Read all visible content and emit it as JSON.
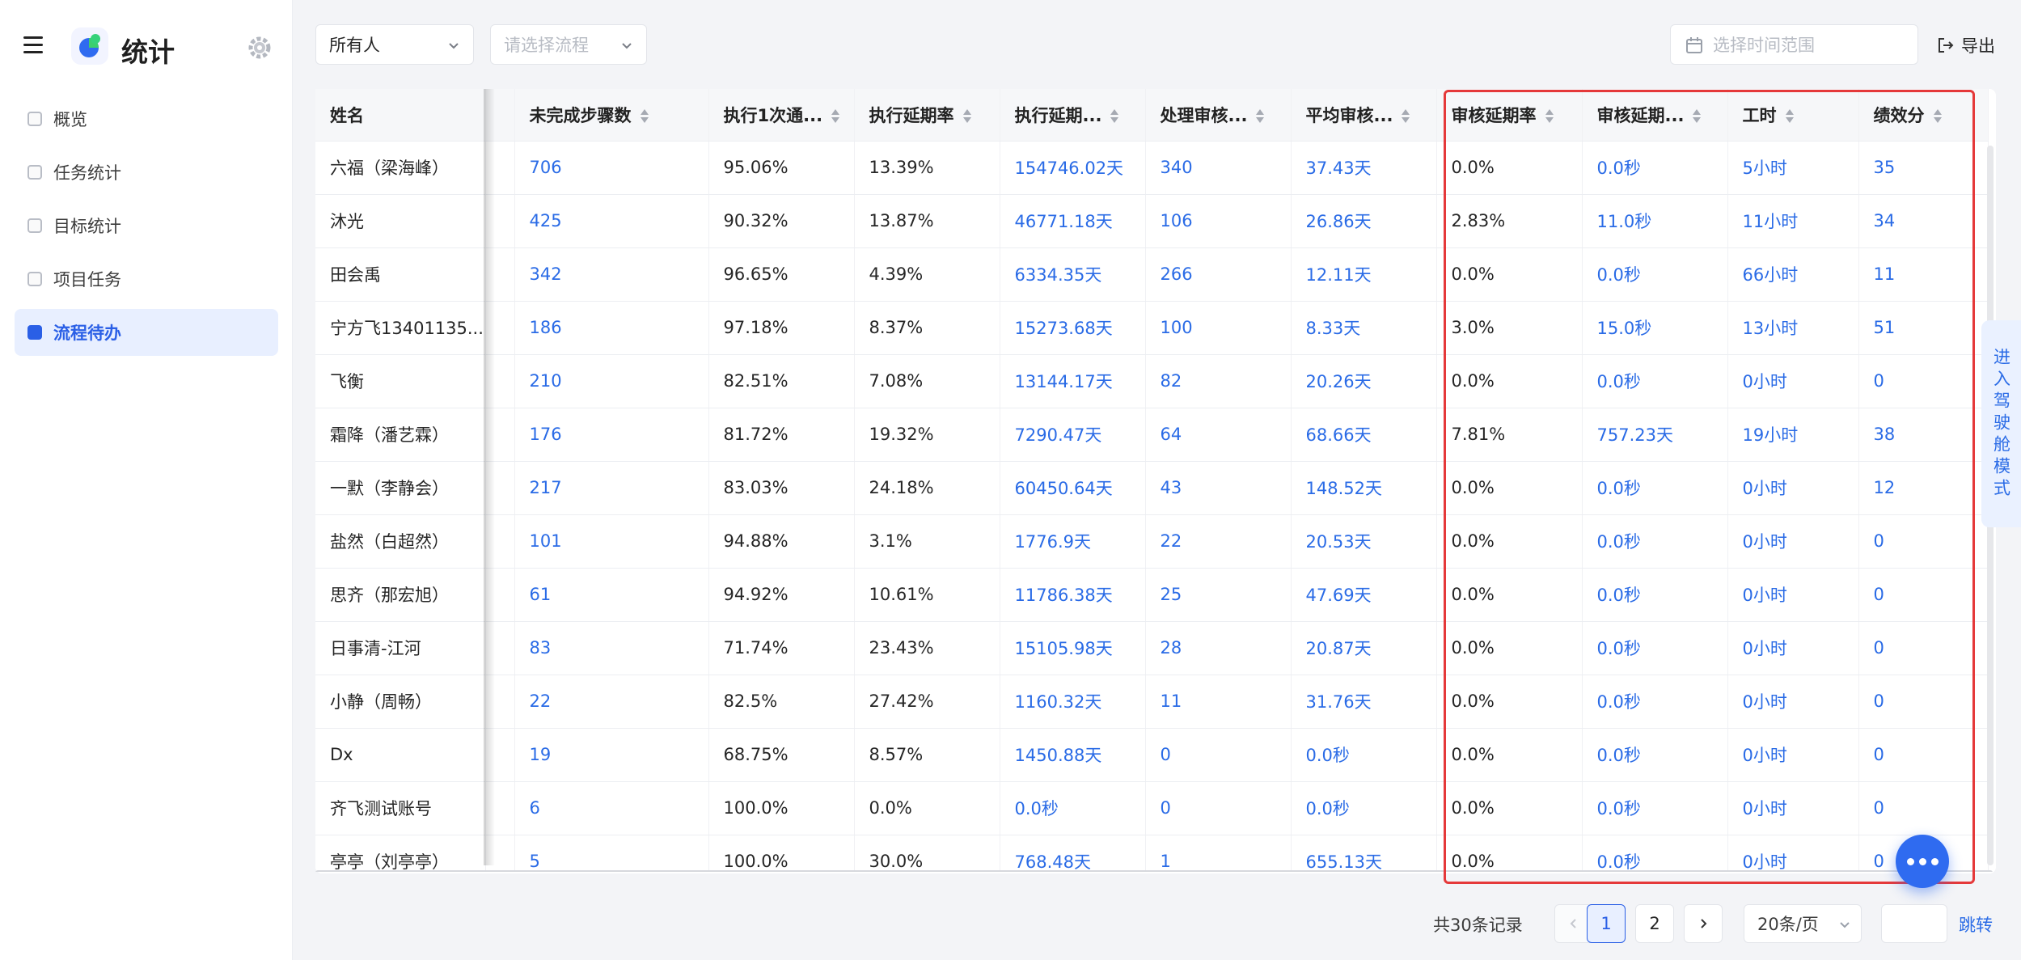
{
  "app": {
    "title": "统计"
  },
  "sidebar": {
    "items": [
      {
        "label": "概览"
      },
      {
        "label": "任务统计"
      },
      {
        "label": "目标统计"
      },
      {
        "label": "项目任务"
      },
      {
        "label": "流程待办"
      }
    ],
    "active_index": 4
  },
  "toolbar": {
    "owner_select": "所有人",
    "process_placeholder": "请选择流程",
    "date_placeholder": "选择时间范围",
    "export_label": "导出"
  },
  "table": {
    "headers": [
      "姓名",
      "未完成步骤数",
      "执行1次通...",
      "执行延期率",
      "执行延期...",
      "处理审核...",
      "平均审核...",
      "审核延期率",
      "审核延期...",
      "工时",
      "绩效分"
    ],
    "rows": [
      [
        "六福（梁海峰）",
        "706",
        "95.06%",
        "13.39%",
        "154746.02天",
        "340",
        "37.43天",
        "0.0%",
        "0.0秒",
        "5小时",
        "35"
      ],
      [
        "沐光",
        "425",
        "90.32%",
        "13.87%",
        "46771.18天",
        "106",
        "26.86天",
        "2.83%",
        "11.0秒",
        "11小时",
        "34"
      ],
      [
        "田会禹",
        "342",
        "96.65%",
        "4.39%",
        "6334.35天",
        "266",
        "12.11天",
        "0.0%",
        "0.0秒",
        "66小时",
        "11"
      ],
      [
        "宁方飞13401135...",
        "186",
        "97.18%",
        "8.37%",
        "15273.68天",
        "100",
        "8.33天",
        "3.0%",
        "15.0秒",
        "13小时",
        "51"
      ],
      [
        "飞衡",
        "210",
        "82.51%",
        "7.08%",
        "13144.17天",
        "82",
        "20.26天",
        "0.0%",
        "0.0秒",
        "0小时",
        "0"
      ],
      [
        "霜降（潘艺霖）",
        "176",
        "81.72%",
        "19.32%",
        "7290.47天",
        "64",
        "68.66天",
        "7.81%",
        "757.23天",
        "19小时",
        "38"
      ],
      [
        "一默（李静会）",
        "217",
        "83.03%",
        "24.18%",
        "60450.64天",
        "43",
        "148.52天",
        "0.0%",
        "0.0秒",
        "0小时",
        "12"
      ],
      [
        "盐然（白超然）",
        "101",
        "94.88%",
        "3.1%",
        "1776.9天",
        "22",
        "20.53天",
        "0.0%",
        "0.0秒",
        "0小时",
        "0"
      ],
      [
        "思齐（那宏旭）",
        "61",
        "94.92%",
        "10.61%",
        "11786.38天",
        "25",
        "47.69天",
        "0.0%",
        "0.0秒",
        "0小时",
        "0"
      ],
      [
        "日事清-江河",
        "83",
        "71.74%",
        "23.43%",
        "15105.98天",
        "28",
        "20.87天",
        "0.0%",
        "0.0秒",
        "0小时",
        "0"
      ],
      [
        "小静（周畅）",
        "22",
        "82.5%",
        "27.42%",
        "1160.32天",
        "11",
        "31.76天",
        "0.0%",
        "0.0秒",
        "0小时",
        "0"
      ],
      [
        "Dx",
        "19",
        "68.75%",
        "8.57%",
        "1450.88天",
        "0",
        "0.0秒",
        "0.0%",
        "0.0秒",
        "0小时",
        "0"
      ],
      [
        "齐飞测试账号",
        "6",
        "100.0%",
        "0.0%",
        "0.0秒",
        "0",
        "0.0秒",
        "0.0%",
        "0.0秒",
        "0小时",
        "0"
      ],
      [
        "亭亭（刘亭亭）",
        "5",
        "100.0%",
        "30.0%",
        "768.48天",
        "1",
        "655.13天",
        "0.0%",
        "0.0秒",
        "0小时",
        "0"
      ]
    ]
  },
  "cockpit_tab": "进入驾驶舱模式",
  "pagination": {
    "total": "共30条记录",
    "pages": [
      "1",
      "2"
    ],
    "current": "1",
    "page_size": "20条/页",
    "jump_label": "跳转"
  },
  "colors": {
    "accent": "#2a6be6",
    "highlight": "#e5393a"
  }
}
